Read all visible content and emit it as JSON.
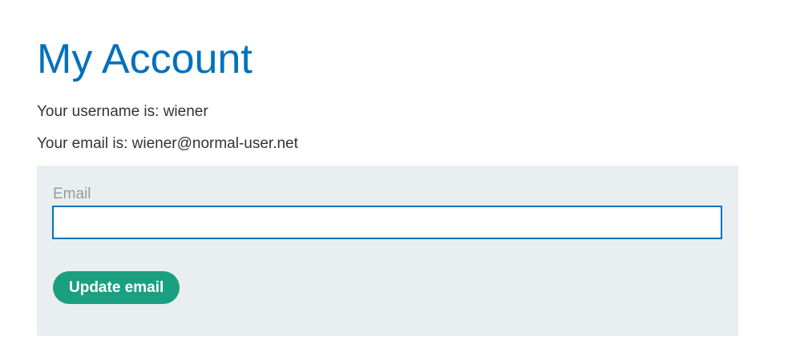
{
  "page": {
    "title": "My Account"
  },
  "account": {
    "username_line": "Your username is: wiener",
    "email_line": "Your email is: wiener@normal-user.net"
  },
  "form": {
    "email_label": "Email",
    "email_value": "",
    "submit_label": "Update email"
  },
  "colors": {
    "title": "#0071bc",
    "panel_background": "#e9eef1",
    "input_border": "#0071bc",
    "button_background": "#1aa081",
    "button_text": "#ffffff"
  }
}
